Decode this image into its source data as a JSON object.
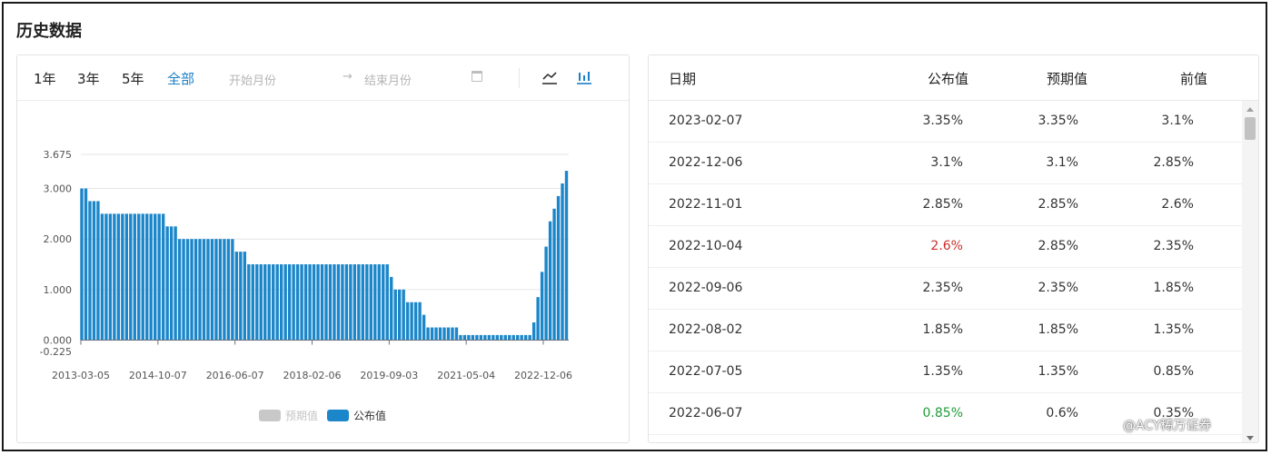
{
  "section_title": "历史数据",
  "toolbar": {
    "ranges": [
      "1年",
      "3年",
      "5年",
      "全部"
    ],
    "active_range": "全部",
    "start_placeholder": "开始月份",
    "arrow": "→",
    "end_placeholder": "结束月份"
  },
  "legend": {
    "forecast": "预期值",
    "actual": "公布值"
  },
  "colors": {
    "bar": "#1b86c9",
    "active": "#1a7fc8",
    "legend_off": "#c8c8c8",
    "red": "#c9302c",
    "green": "#1f9d3a"
  },
  "chart_data": {
    "type": "bar",
    "y_ticks": [
      "-0.225",
      "0.000",
      "1.000",
      "2.000",
      "3.000",
      "3.675"
    ],
    "ylim": [
      -0.225,
      3.675
    ],
    "x_ticks": [
      "2013-03-05",
      "2014-10-07",
      "2016-06-07",
      "2018-02-06",
      "2019-09-03",
      "2021-05-04",
      "2022-12-06"
    ],
    "series": [
      {
        "name": "公布值",
        "values": [
          3,
          3,
          2.75,
          2.75,
          2.75,
          2.5,
          2.5,
          2.5,
          2.5,
          2.5,
          2.5,
          2.5,
          2.5,
          2.5,
          2.5,
          2.5,
          2.5,
          2.5,
          2.5,
          2.5,
          2.5,
          2.25,
          2.25,
          2.25,
          2,
          2,
          2,
          2,
          2,
          2,
          2,
          2,
          2,
          2,
          2,
          2,
          2,
          2,
          1.75,
          1.75,
          1.75,
          1.5,
          1.5,
          1.5,
          1.5,
          1.5,
          1.5,
          1.5,
          1.5,
          1.5,
          1.5,
          1.5,
          1.5,
          1.5,
          1.5,
          1.5,
          1.5,
          1.5,
          1.5,
          1.5,
          1.5,
          1.5,
          1.5,
          1.5,
          1.5,
          1.5,
          1.5,
          1.5,
          1.5,
          1.5,
          1.5,
          1.5,
          1.5,
          1.5,
          1.5,
          1.5,
          1.25,
          1,
          1,
          1,
          0.75,
          0.75,
          0.75,
          0.75,
          0.5,
          0.25,
          0.25,
          0.25,
          0.25,
          0.25,
          0.25,
          0.25,
          0.25,
          0.1,
          0.1,
          0.1,
          0.1,
          0.1,
          0.1,
          0.1,
          0.1,
          0.1,
          0.1,
          0.1,
          0.1,
          0.1,
          0.1,
          0.1,
          0.1,
          0.1,
          0.1,
          0.35,
          0.85,
          1.35,
          1.85,
          2.35,
          2.6,
          2.85,
          3.1,
          3.35
        ]
      }
    ]
  },
  "table": {
    "headers": [
      "日期",
      "公布值",
      "预期值",
      "前值"
    ],
    "rows": [
      {
        "date": "2023-02-07",
        "actual": "3.35%",
        "forecast": "3.35%",
        "previous": "3.1%",
        "tone": ""
      },
      {
        "date": "2022-12-06",
        "actual": "3.1%",
        "forecast": "3.1%",
        "previous": "2.85%",
        "tone": ""
      },
      {
        "date": "2022-11-01",
        "actual": "2.85%",
        "forecast": "2.85%",
        "previous": "2.6%",
        "tone": ""
      },
      {
        "date": "2022-10-04",
        "actual": "2.6%",
        "forecast": "2.85%",
        "previous": "2.35%",
        "tone": "red"
      },
      {
        "date": "2022-09-06",
        "actual": "2.35%",
        "forecast": "2.35%",
        "previous": "1.85%",
        "tone": ""
      },
      {
        "date": "2022-08-02",
        "actual": "1.85%",
        "forecast": "1.85%",
        "previous": "1.35%",
        "tone": ""
      },
      {
        "date": "2022-07-05",
        "actual": "1.35%",
        "forecast": "1.35%",
        "previous": "0.85%",
        "tone": ""
      },
      {
        "date": "2022-06-07",
        "actual": "0.85%",
        "forecast": "0.6%",
        "previous": "0.35%",
        "tone": "green"
      }
    ]
  },
  "watermark": "@ACY稀万证券"
}
